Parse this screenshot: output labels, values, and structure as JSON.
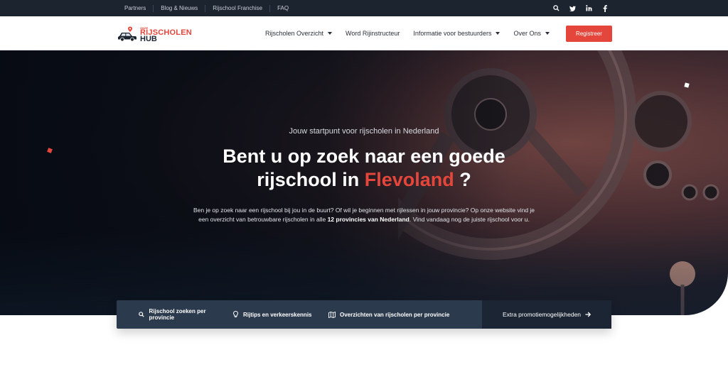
{
  "topbar": {
    "links": [
      {
        "label": "Partners"
      },
      {
        "label": "Blog & Nieuws"
      },
      {
        "label": "Rijschool Franchise"
      },
      {
        "label": "FAQ"
      }
    ],
    "icons": [
      "search-icon",
      "twitter-icon",
      "linkedin-icon",
      "facebook-icon"
    ]
  },
  "header": {
    "logo": {
      "top": "ONZE",
      "line1": "RIJSCHOLEN",
      "line2": "HUB"
    },
    "nav": [
      {
        "label": "Rijscholen Overzicht",
        "has_dropdown": true
      },
      {
        "label": "Word Rijinstructeur",
        "has_dropdown": false
      },
      {
        "label": "Informatie voor bestuurders",
        "has_dropdown": true
      },
      {
        "label": "Over Ons",
        "has_dropdown": true
      }
    ],
    "register_label": "Registreer"
  },
  "hero": {
    "eyebrow": "Jouw startpunt voor rijscholen in Nederland",
    "title_line1": "Bent u op zoek naar een goede",
    "title_line2_prefix": "rijschool in",
    "title_accent": "Flevoland",
    "title_suffix": "?",
    "lead_part1": "Ben je op zoek naar een rijschool bij jou in de buurt? Of wil je beginnen met rijlessen in jouw provincie? Op onze website vind je een overzicht van betrouwbare rijscholen in alle",
    "lead_bold": "12 provincies van Nederland",
    "lead_part2": ". Vind vandaag nog de juiste rijschool voor u."
  },
  "tabs": [
    {
      "label": "Rijschool zoeken per provincie",
      "icon": "search-icon"
    },
    {
      "label": "Rijtips en verkeerskennis",
      "icon": "lightbulb-icon"
    },
    {
      "label": "Overzichten van rijscholen per provincie",
      "icon": "map-icon"
    },
    {
      "label": "Extra promotiemogelijkheden",
      "icon": "arrow-right-icon"
    }
  ],
  "colors": {
    "accent": "#e4463c",
    "dark": "#1c2430",
    "tabbar": "#2b3a4d"
  }
}
